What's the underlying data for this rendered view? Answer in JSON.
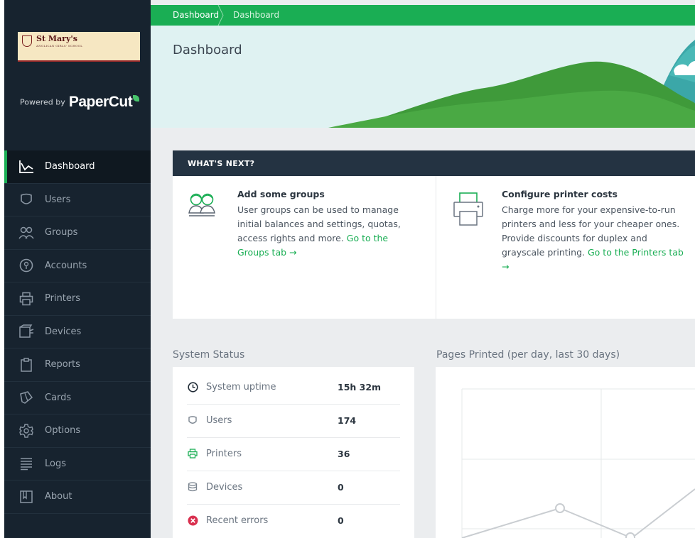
{
  "brand": {
    "school_name": "St Mary's",
    "school_subtitle": "ANGLICAN GIRLS' SCHOOL",
    "powered_by": "Powered by",
    "product": "PaperCut"
  },
  "breadcrumb": [
    "Dashboard",
    "Dashboard"
  ],
  "page_title": "Dashboard",
  "sidebar": {
    "items": [
      {
        "label": "Dashboard",
        "icon": "dashboard-icon",
        "active": true
      },
      {
        "label": "Users",
        "icon": "users-icon"
      },
      {
        "label": "Groups",
        "icon": "groups-icon"
      },
      {
        "label": "Accounts",
        "icon": "accounts-icon"
      },
      {
        "label": "Printers",
        "icon": "printer-icon"
      },
      {
        "label": "Devices",
        "icon": "devices-icon"
      },
      {
        "label": "Reports",
        "icon": "reports-icon"
      },
      {
        "label": "Cards",
        "icon": "cards-icon"
      },
      {
        "label": "Options",
        "icon": "options-icon"
      },
      {
        "label": "Logs",
        "icon": "logs-icon"
      },
      {
        "label": "About",
        "icon": "about-icon"
      }
    ]
  },
  "whats_next": {
    "heading": "WHAT'S NEXT?",
    "groups": {
      "title": "Add some groups",
      "text": "User groups can be used to manage initial balances and settings, quotas, access rights and more.",
      "link": "Go to the Groups tab →"
    },
    "printers": {
      "title": "Configure printer costs",
      "text": "Charge more for your expensive-to-run printers and less for your cheaper ones. Provide discounts for duplex and grayscale printing.",
      "link": "Go to the Printers tab →"
    }
  },
  "system_status": {
    "title": "System Status",
    "rows": [
      {
        "label": "System uptime",
        "value": "15h 32m",
        "icon": "clock-icon"
      },
      {
        "label": "Users",
        "value": "174",
        "icon": "users-icon"
      },
      {
        "label": "Printers",
        "value": "36",
        "icon": "printer-icon"
      },
      {
        "label": "Devices",
        "value": "0",
        "icon": "devices-icon"
      },
      {
        "label": "Recent errors",
        "value": "0",
        "icon": "error-icon"
      }
    ]
  },
  "pages_printed": {
    "title": "Pages Printed (per day, last 30 days)"
  },
  "colors": {
    "accent": "#1aae54",
    "sidebar": "#17232f",
    "header_bar": "#243342",
    "error": "#d9304f"
  }
}
